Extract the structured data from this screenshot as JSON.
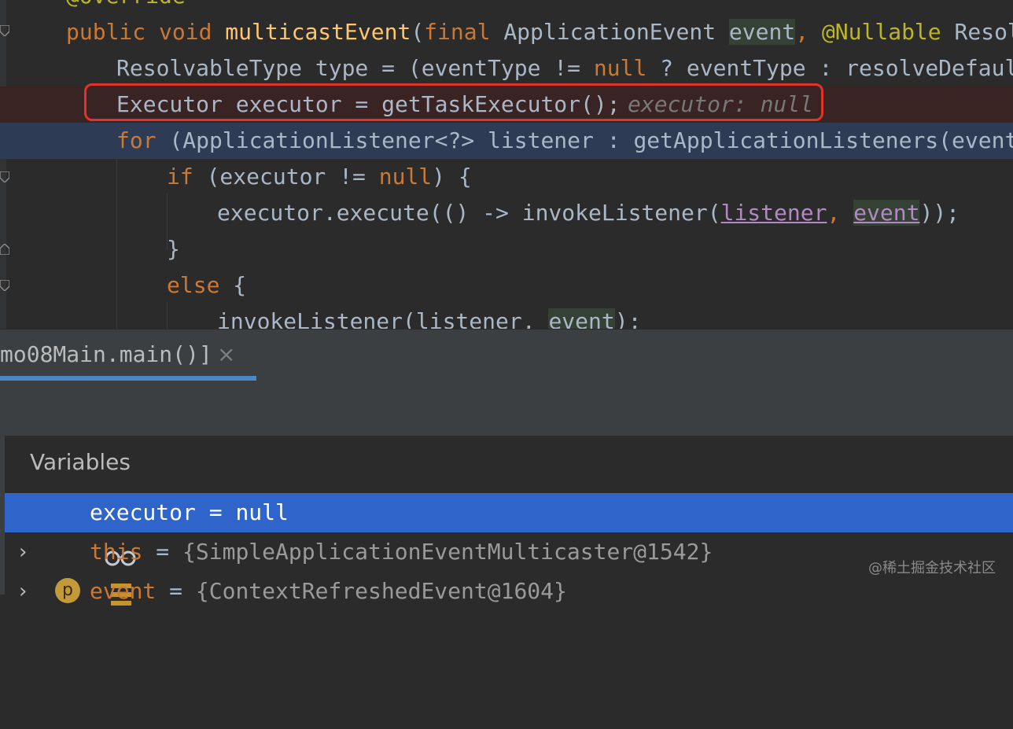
{
  "editor": {
    "line0": {
      "text": "@Override"
    },
    "line1": {
      "t1": "public void ",
      "method": "multicastEvent",
      "t2": "(",
      "t3": "final ",
      "t4": "ApplicationEvent ",
      "param": "event",
      "t5": ", ",
      "annotation": "@Nullable",
      "t6": " ResolvableT"
    },
    "line2": {
      "t1": "ResolvableType type = (eventType != ",
      "null1": "null",
      "t2": " ? eventType : resolveDefaultEve"
    },
    "line3": {
      "t1": "Executor executor = getTaskExecutor();",
      "hint": "executor: null"
    },
    "line4": {
      "kw": "for",
      "t1": " (ApplicationListener<?> listener : getApplicationListeners(event, ty"
    },
    "line5": {
      "kw": "if",
      "t1": " (executor != ",
      "null1": "null",
      "t2": ") {"
    },
    "line6": {
      "t1": "executor.execute(() -> invokeListener(",
      "a1": "listener",
      "t2": ", ",
      "a2": "event",
      "t3": "));"
    },
    "line7": {
      "t1": "}"
    },
    "line8": {
      "kw": "else",
      "t1": " {"
    },
    "line9": {
      "t1": "invokeListener(listener, ",
      "a1": "event",
      "t2": ");"
    }
  },
  "debug": {
    "tab_label": "mo08Main.main()]",
    "close_glyph": "×",
    "variables_header": "Variables",
    "rows": [
      {
        "name": "executor",
        "eq": " = ",
        "value": "null",
        "icon": "watch-glasses-icon",
        "expandable": false
      },
      {
        "name": "this",
        "eq": " = ",
        "value": "{SimpleApplicationEventMulticaster@1542}",
        "icon": "field-bars-icon",
        "expandable": true
      },
      {
        "name": "event",
        "eq": " = ",
        "value": "{ContextRefreshedEvent@1604}",
        "icon": "parameter-p-icon",
        "icon_letter": "p",
        "expandable": true
      }
    ],
    "chevron_glyph": "›"
  },
  "watermark": "@稀土掘金技术社区",
  "colors": {
    "keyword": "#cc7832",
    "method": "#ffc66d",
    "annotation": "#bbb529",
    "breakpoint_bg": "#3a2323",
    "execution_bg": "#2d3b55",
    "selected_row": "#2f65ca",
    "highlight_box": "#e0342a"
  }
}
